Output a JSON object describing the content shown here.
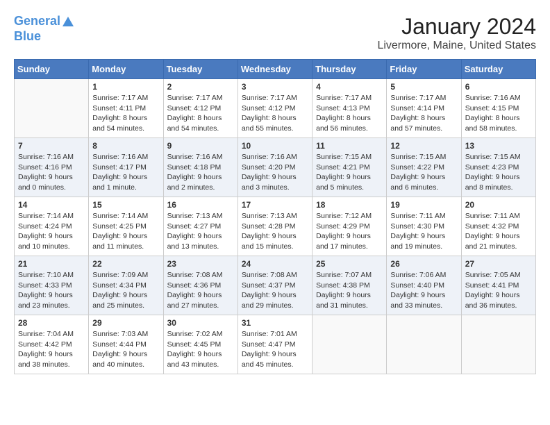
{
  "header": {
    "logo_line1": "General",
    "logo_line2": "Blue",
    "month_title": "January 2024",
    "location": "Livermore, Maine, United States"
  },
  "days_of_week": [
    "Sunday",
    "Monday",
    "Tuesday",
    "Wednesday",
    "Thursday",
    "Friday",
    "Saturday"
  ],
  "weeks": [
    [
      {
        "day": "",
        "info": ""
      },
      {
        "day": "1",
        "info": "Sunrise: 7:17 AM\nSunset: 4:11 PM\nDaylight: 8 hours\nand 54 minutes."
      },
      {
        "day": "2",
        "info": "Sunrise: 7:17 AM\nSunset: 4:12 PM\nDaylight: 8 hours\nand 54 minutes."
      },
      {
        "day": "3",
        "info": "Sunrise: 7:17 AM\nSunset: 4:12 PM\nDaylight: 8 hours\nand 55 minutes."
      },
      {
        "day": "4",
        "info": "Sunrise: 7:17 AM\nSunset: 4:13 PM\nDaylight: 8 hours\nand 56 minutes."
      },
      {
        "day": "5",
        "info": "Sunrise: 7:17 AM\nSunset: 4:14 PM\nDaylight: 8 hours\nand 57 minutes."
      },
      {
        "day": "6",
        "info": "Sunrise: 7:16 AM\nSunset: 4:15 PM\nDaylight: 8 hours\nand 58 minutes."
      }
    ],
    [
      {
        "day": "7",
        "info": "Sunrise: 7:16 AM\nSunset: 4:16 PM\nDaylight: 9 hours\nand 0 minutes."
      },
      {
        "day": "8",
        "info": "Sunrise: 7:16 AM\nSunset: 4:17 PM\nDaylight: 9 hours\nand 1 minute."
      },
      {
        "day": "9",
        "info": "Sunrise: 7:16 AM\nSunset: 4:18 PM\nDaylight: 9 hours\nand 2 minutes."
      },
      {
        "day": "10",
        "info": "Sunrise: 7:16 AM\nSunset: 4:20 PM\nDaylight: 9 hours\nand 3 minutes."
      },
      {
        "day": "11",
        "info": "Sunrise: 7:15 AM\nSunset: 4:21 PM\nDaylight: 9 hours\nand 5 minutes."
      },
      {
        "day": "12",
        "info": "Sunrise: 7:15 AM\nSunset: 4:22 PM\nDaylight: 9 hours\nand 6 minutes."
      },
      {
        "day": "13",
        "info": "Sunrise: 7:15 AM\nSunset: 4:23 PM\nDaylight: 9 hours\nand 8 minutes."
      }
    ],
    [
      {
        "day": "14",
        "info": "Sunrise: 7:14 AM\nSunset: 4:24 PM\nDaylight: 9 hours\nand 10 minutes."
      },
      {
        "day": "15",
        "info": "Sunrise: 7:14 AM\nSunset: 4:25 PM\nDaylight: 9 hours\nand 11 minutes."
      },
      {
        "day": "16",
        "info": "Sunrise: 7:13 AM\nSunset: 4:27 PM\nDaylight: 9 hours\nand 13 minutes."
      },
      {
        "day": "17",
        "info": "Sunrise: 7:13 AM\nSunset: 4:28 PM\nDaylight: 9 hours\nand 15 minutes."
      },
      {
        "day": "18",
        "info": "Sunrise: 7:12 AM\nSunset: 4:29 PM\nDaylight: 9 hours\nand 17 minutes."
      },
      {
        "day": "19",
        "info": "Sunrise: 7:11 AM\nSunset: 4:30 PM\nDaylight: 9 hours\nand 19 minutes."
      },
      {
        "day": "20",
        "info": "Sunrise: 7:11 AM\nSunset: 4:32 PM\nDaylight: 9 hours\nand 21 minutes."
      }
    ],
    [
      {
        "day": "21",
        "info": "Sunrise: 7:10 AM\nSunset: 4:33 PM\nDaylight: 9 hours\nand 23 minutes."
      },
      {
        "day": "22",
        "info": "Sunrise: 7:09 AM\nSunset: 4:34 PM\nDaylight: 9 hours\nand 25 minutes."
      },
      {
        "day": "23",
        "info": "Sunrise: 7:08 AM\nSunset: 4:36 PM\nDaylight: 9 hours\nand 27 minutes."
      },
      {
        "day": "24",
        "info": "Sunrise: 7:08 AM\nSunset: 4:37 PM\nDaylight: 9 hours\nand 29 minutes."
      },
      {
        "day": "25",
        "info": "Sunrise: 7:07 AM\nSunset: 4:38 PM\nDaylight: 9 hours\nand 31 minutes."
      },
      {
        "day": "26",
        "info": "Sunrise: 7:06 AM\nSunset: 4:40 PM\nDaylight: 9 hours\nand 33 minutes."
      },
      {
        "day": "27",
        "info": "Sunrise: 7:05 AM\nSunset: 4:41 PM\nDaylight: 9 hours\nand 36 minutes."
      }
    ],
    [
      {
        "day": "28",
        "info": "Sunrise: 7:04 AM\nSunset: 4:42 PM\nDaylight: 9 hours\nand 38 minutes."
      },
      {
        "day": "29",
        "info": "Sunrise: 7:03 AM\nSunset: 4:44 PM\nDaylight: 9 hours\nand 40 minutes."
      },
      {
        "day": "30",
        "info": "Sunrise: 7:02 AM\nSunset: 4:45 PM\nDaylight: 9 hours\nand 43 minutes."
      },
      {
        "day": "31",
        "info": "Sunrise: 7:01 AM\nSunset: 4:47 PM\nDaylight: 9 hours\nand 45 minutes."
      },
      {
        "day": "",
        "info": ""
      },
      {
        "day": "",
        "info": ""
      },
      {
        "day": "",
        "info": ""
      }
    ]
  ]
}
